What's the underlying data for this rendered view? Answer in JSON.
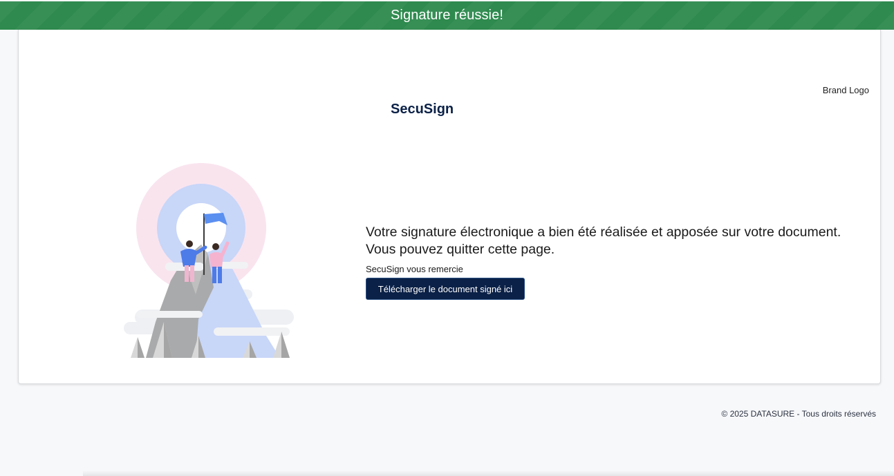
{
  "banner": {
    "text": "Signature réussie!"
  },
  "header": {
    "brand_logo_alt": "Brand Logo",
    "app_name": "SecuSign"
  },
  "main": {
    "message_line_1": "Votre signature électronique a bien été réalisée et apposée sur votre document.",
    "message_line_2": "Vous pouvez quitter cette page.",
    "thanks": "SecuSign vous remercie",
    "download_label": "Télécharger le document signé ici"
  },
  "footer": {
    "copyright": "© 2025 DATASURE - Tous droits réservés"
  },
  "colors": {
    "banner_green": "#2e8a4e",
    "brand_navy": "#0b2147",
    "page_bg": "#f7f8fa"
  },
  "icons": {
    "illustration": "mountain-summit-flag-illustration"
  }
}
